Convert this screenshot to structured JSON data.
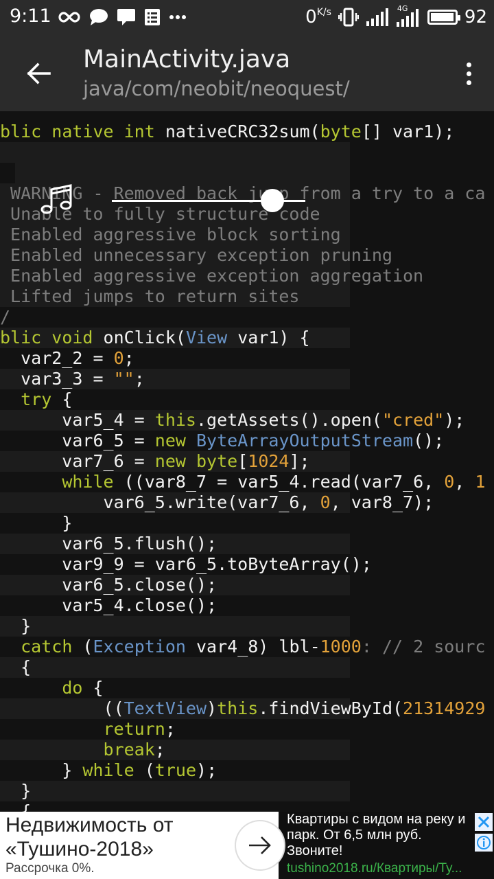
{
  "status_bar": {
    "time": "9:11",
    "net_speed": "0",
    "net_speed_unit": "K/s",
    "network_badge": "4G",
    "battery_level": "92",
    "left_icons": [
      "infinity-icon",
      "chat-bubble-icon",
      "message-icon",
      "list-icon",
      "more-dots-icon"
    ],
    "right_icons": [
      "vibrate-icon",
      "signal-icon",
      "signal-4g-icon",
      "battery-icon"
    ]
  },
  "app_bar": {
    "title": "MainActivity.java",
    "subtitle": "java/com/neobit/neoquest/"
  },
  "colors": {
    "keyword": "#b5c732",
    "number": "#e3a23a",
    "string": "#e3a23a",
    "type": "#6a95c9",
    "comment": "#7d7d7d",
    "text": "#f2f2f2"
  },
  "code_lines": [
    [
      [
        "blic ",
        "kw"
      ],
      [
        "native ",
        "kw"
      ],
      [
        "int ",
        "kw"
      ],
      [
        "nativeCRC32sum(",
        "plain"
      ],
      [
        "byte",
        "kw"
      ],
      [
        "[] var1);",
        "plain"
      ]
    ],
    [],
    [
      [
        "",
        "plain"
      ]
    ],
    [
      [
        " WARNING - Removed back jump from a try to a ca",
        "cmt"
      ]
    ],
    [
      [
        " Unable to fully structure code",
        "cmt"
      ]
    ],
    [
      [
        " Enabled aggressive block sorting",
        "cmt"
      ]
    ],
    [
      [
        " Enabled unnecessary exception pruning",
        "cmt"
      ]
    ],
    [
      [
        " Enabled aggressive exception aggregation",
        "cmt"
      ]
    ],
    [
      [
        " Lifted jumps to return sites",
        "cmt"
      ]
    ],
    [
      [
        "/",
        "cmt"
      ]
    ],
    [
      [
        "blic ",
        "kw"
      ],
      [
        "void ",
        "kw"
      ],
      [
        "onClick(",
        "plain"
      ],
      [
        "View",
        "type"
      ],
      [
        " var1) {",
        "plain"
      ]
    ],
    [
      [
        "  var2_2 = ",
        "plain"
      ],
      [
        "0",
        "num"
      ],
      [
        ";",
        "plain"
      ]
    ],
    [
      [
        "  var3_3 = ",
        "plain"
      ],
      [
        "\"\"",
        "str"
      ],
      [
        ";",
        "plain"
      ]
    ],
    [
      [
        "  ",
        "plain"
      ],
      [
        "try",
        "kw"
      ],
      [
        " {",
        "plain"
      ]
    ],
    [
      [
        "      var5_4 = ",
        "plain"
      ],
      [
        "this",
        "kw"
      ],
      [
        ".getAssets().open(",
        "plain"
      ],
      [
        "\"cred\"",
        "str"
      ],
      [
        ");",
        "plain"
      ]
    ],
    [
      [
        "      var6_5 = ",
        "plain"
      ],
      [
        "new ",
        "kw"
      ],
      [
        "ByteArrayOutputStream",
        "type"
      ],
      [
        "();",
        "plain"
      ]
    ],
    [
      [
        "      var7_6 = ",
        "plain"
      ],
      [
        "new ",
        "kw"
      ],
      [
        "byte",
        "kw"
      ],
      [
        "[",
        "plain"
      ],
      [
        "1024",
        "num"
      ],
      [
        "];",
        "plain"
      ]
    ],
    [
      [
        "      ",
        "plain"
      ],
      [
        "while",
        "kw"
      ],
      [
        " ((var8_7 = var5_4.read(var7_6, ",
        "plain"
      ],
      [
        "0",
        "num"
      ],
      [
        ", ",
        "plain"
      ],
      [
        "1",
        "num"
      ]
    ],
    [
      [
        "          var6_5.write(var7_6, ",
        "plain"
      ],
      [
        "0",
        "num"
      ],
      [
        ", var8_7);",
        "plain"
      ]
    ],
    [
      [
        "      }",
        "plain"
      ]
    ],
    [
      [
        "      var6_5.flush();",
        "plain"
      ]
    ],
    [
      [
        "      var9_9 = var6_5.toByteArray();",
        "plain"
      ]
    ],
    [
      [
        "      var6_5.close();",
        "plain"
      ]
    ],
    [
      [
        "      var5_4.close();",
        "plain"
      ]
    ],
    [
      [
        "  }",
        "plain"
      ]
    ],
    [
      [
        "  ",
        "plain"
      ],
      [
        "catch",
        "kw"
      ],
      [
        " (",
        "plain"
      ],
      [
        "Exception",
        "type"
      ],
      [
        " var4_8) lbl-",
        "plain"
      ],
      [
        "1000",
        "num"
      ],
      [
        ": // 2 sourc",
        "cmt"
      ]
    ],
    [
      [
        "  {",
        "plain"
      ]
    ],
    [
      [
        "      ",
        "plain"
      ],
      [
        "do",
        "kw"
      ],
      [
        " {",
        "plain"
      ]
    ],
    [
      [
        "          ((",
        "plain"
      ],
      [
        "TextView",
        "type"
      ],
      [
        ")",
        "plain"
      ],
      [
        "this",
        "kw"
      ],
      [
        ".findViewById(",
        "plain"
      ],
      [
        "21314929",
        "num"
      ]
    ],
    [
      [
        "          ",
        "plain"
      ],
      [
        "return",
        "kw"
      ],
      [
        ";",
        "plain"
      ]
    ],
    [
      [
        "          ",
        "plain"
      ],
      [
        "break",
        "kw"
      ],
      [
        ";",
        "plain"
      ]
    ],
    [
      [
        "      } ",
        "plain"
      ],
      [
        "while",
        "kw"
      ],
      [
        " (",
        "plain"
      ],
      [
        "true",
        "kw"
      ],
      [
        ");",
        "plain"
      ]
    ],
    [
      [
        "  }",
        "plain"
      ]
    ],
    [
      [
        "  {",
        "plain"
      ]
    ]
  ],
  "music_widget": {
    "icon": "music-note-icon",
    "slider_position": 0.83
  },
  "ad": {
    "headline": "Недвижимость от «Тушино-2018»",
    "subtext": "Рассрочка 0%.",
    "body": "Квартиры с видом на реку и парк. От 6,5 млн руб. Звоните!",
    "url": "tushino2018.ru/Квартиры/Ту...",
    "close_icon": "close-icon",
    "info_icon": "info-icon"
  }
}
